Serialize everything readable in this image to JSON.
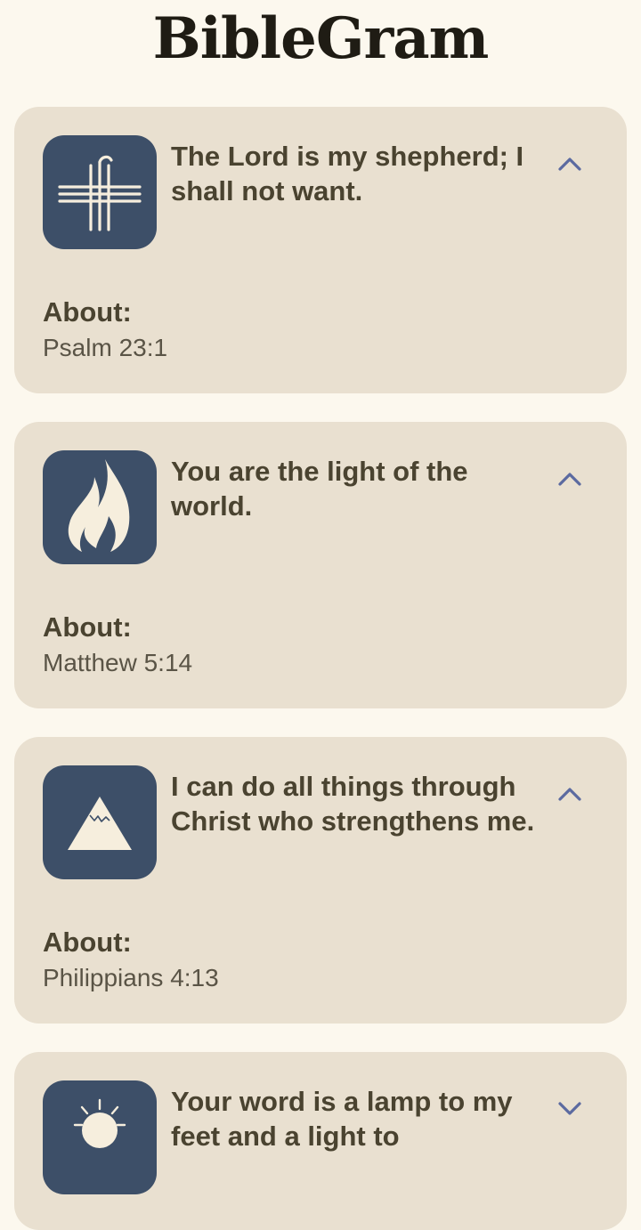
{
  "app": {
    "title": "BibleGram"
  },
  "verses": [
    {
      "text": "The Lord is my shepherd; I shall not want.",
      "about_label": "About:",
      "reference": "Psalm 23:1",
      "icon": "cross-icon",
      "expanded": true
    },
    {
      "text": "You are the light of the world.",
      "about_label": "About:",
      "reference": "Matthew 5:14",
      "icon": "flame-icon",
      "expanded": true
    },
    {
      "text": "I can do all things through Christ who strengthens me.",
      "about_label": "About:",
      "reference": "Philippians 4:13",
      "icon": "mountain-icon",
      "expanded": true
    },
    {
      "text": "Your word is a lamp to my feet and a light to",
      "icon": "lamp-icon",
      "expanded": false
    }
  ],
  "colors": {
    "background": "#fcf8ee",
    "card": "#e9e0d0",
    "icon_tile": "#3d4f68",
    "icon_fg": "#f6eedd",
    "text_primary": "#4a4330",
    "chevron": "#5b6aa0"
  }
}
